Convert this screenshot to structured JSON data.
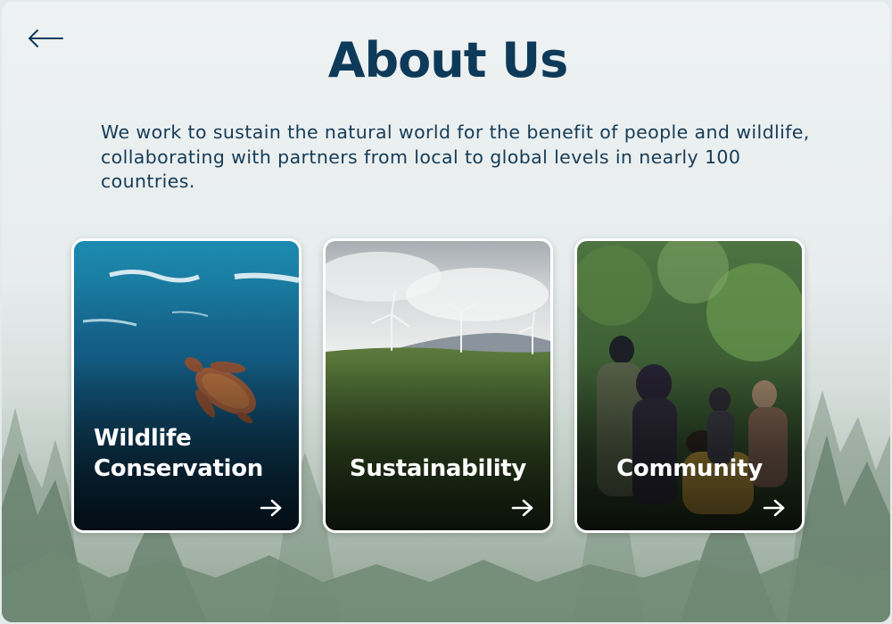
{
  "page": {
    "title": "About Us",
    "intro": "We work to sustain the natural world for the benefit of people and wildlife, collaborating with partners from local to global levels in nearly 100 countries."
  },
  "cards": [
    {
      "label": "Wildlife Conservation",
      "image": "sea-turtle-underwater-photo",
      "icon": "arrow-right-icon"
    },
    {
      "label": "Sustainability",
      "image": "wind-turbines-on-green-hills-photo",
      "icon": "arrow-right-icon"
    },
    {
      "label": "Community",
      "image": "people-planting-in-forest-photo",
      "icon": "arrow-right-icon"
    }
  ],
  "icons": {
    "back": "arrow-left-icon"
  },
  "colors": {
    "title": "#0e3a5a",
    "text": "#153c57",
    "card_border": "#ffffff"
  }
}
